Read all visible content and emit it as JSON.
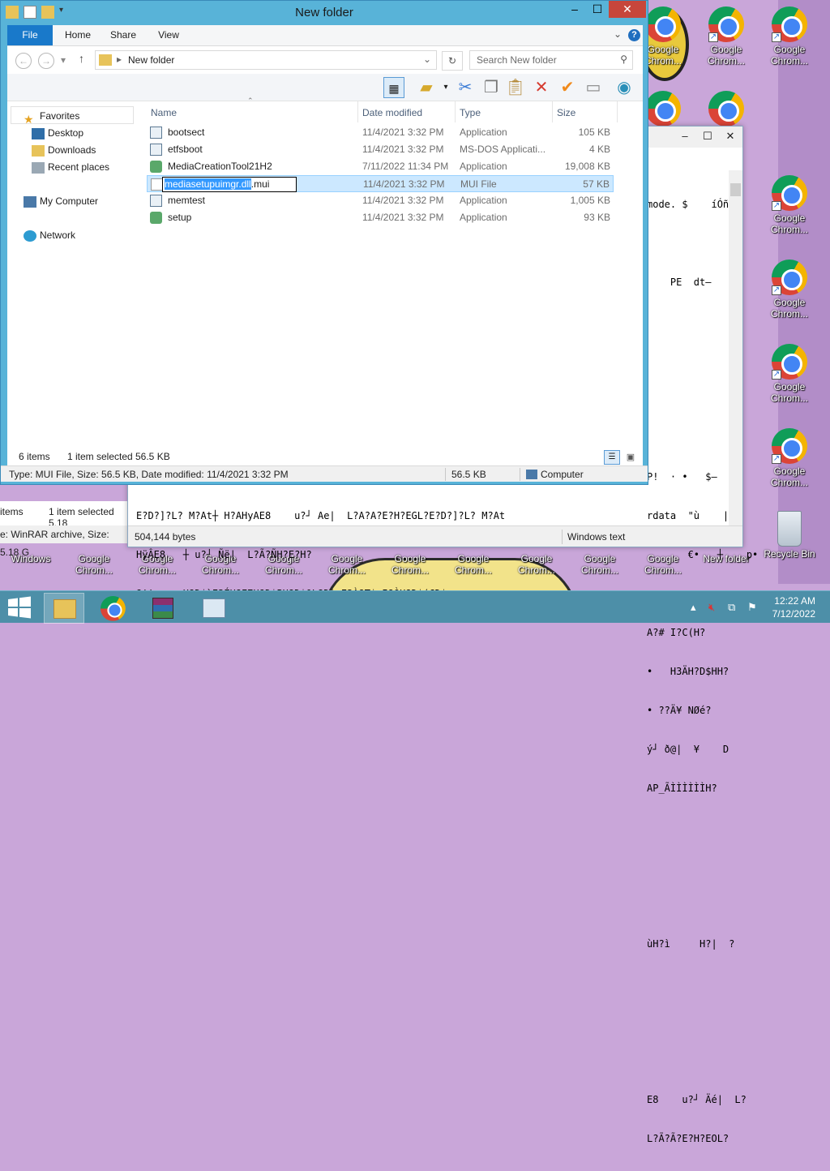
{
  "explorer": {
    "title": "New folder",
    "tabs": {
      "file": "File",
      "home": "Home",
      "share": "Share",
      "view": "View"
    },
    "address": "New folder",
    "search_placeholder": "Search New folder",
    "nav": {
      "favorites": "Favorites",
      "desktop": "Desktop",
      "downloads": "Downloads",
      "recent": "Recent places",
      "computer": "My Computer",
      "network": "Network"
    },
    "columns": {
      "name": "Name",
      "date": "Date modified",
      "type": "Type",
      "size": "Size"
    },
    "files": [
      {
        "name": "bootsect",
        "date": "11/4/2021 3:32 PM",
        "type": "Application",
        "size": "105 KB"
      },
      {
        "name": "etfsboot",
        "date": "11/4/2021 3:32 PM",
        "type": "MS-DOS Applicati...",
        "size": "4 KB"
      },
      {
        "name": "MediaCreationTool21H2",
        "date": "7/11/2022 11:34 PM",
        "type": "Application",
        "size": "19,008 KB"
      },
      {
        "name_selected": "mediasetupuimgr.dll",
        "name_rest": ".mui",
        "date": "11/4/2021 3:32 PM",
        "type": "MUI File",
        "size": "57 KB"
      },
      {
        "name": "memtest",
        "date": "11/4/2021 3:32 PM",
        "type": "Application",
        "size": "1,005 KB"
      },
      {
        "name": "setup",
        "date": "11/4/2021 3:32 PM",
        "type": "Application",
        "size": "93 KB"
      }
    ],
    "status": {
      "count": "6 items",
      "selected": "1 item selected",
      "sel_size": "56.5 KB"
    },
    "details": {
      "info": "Type: MUI File, Size: 56.5 KB, Date modified: 11/4/2021 3:32 PM",
      "size": "56.5 KB",
      "location": "Computer"
    }
  },
  "notepad": {
    "lines_right": [
      "mode. $    íÓñ",
      "",
      "    PE  dt–",
      "",
      "",
      "",
      "",
      "P!  · •   $–",
      "rdata  \"ù    |",
      "       €•   ┼    p•",
      "",
      "A?# I?C(H?",
      "•   H3ÄH?D$HH?",
      "• ??Ä¥ NØé?",
      "ý┘ ð@|  ¥    D",
      "AP_ÃÌÌÌÌÌÌH?",
      "",
      "",
      "",
      "ùH?ì     H?|  ?",
      "",
      "",
      "",
      "E8    u?┘ Äé|  L?",
      "L?Ã?Ã?E?H?EOL?"
    ],
    "lines_bottom": [
      "E?D?]?L? M?At┼ H?AHyAE8    u?┘ Ae|  L?A?A?E?H?EGL?E?D?]?L? M?At",
      "HÿÂE8   ┼ u?┘ Ñë|  L?Ã?ÑH?E?H?",
      "?!! •   H?D$`E3ÉH?E7H?D$PH?D$0L?D$pE3À?T$xI?ÒH?D$(ÇD$"
    ],
    "status_left": "504,144 bytes",
    "status_right": "Windows text"
  },
  "bg_explorer": {
    "count": "items",
    "selected": "1 item selected  5.18",
    "info": "e: WinRAR archive, Size: 5.18 G"
  },
  "desktop": {
    "right_icons": [
      "Google Chrom...",
      "Google Chrom...",
      "Google Chrom...",
      "Google Chrom...",
      "Google Chrom..."
    ],
    "top_icons": [
      "Google Chrom...",
      "Google Chrom...",
      "Google Chrom..."
    ],
    "bottom_icons": [
      "Windows",
      "Google Chrom...",
      "Google Chrom...",
      "Google Chrom...",
      "Google Chrom...",
      "Google Chrom...",
      "Google Chrom...",
      "Google Chrom...",
      "Google Chrom...",
      "Google Chrom...",
      "Google Chrom...",
      "New folder",
      "Recycle Bin"
    ]
  },
  "taskbar": {
    "time": "12:22 AM",
    "date": "7/12/2022"
  }
}
